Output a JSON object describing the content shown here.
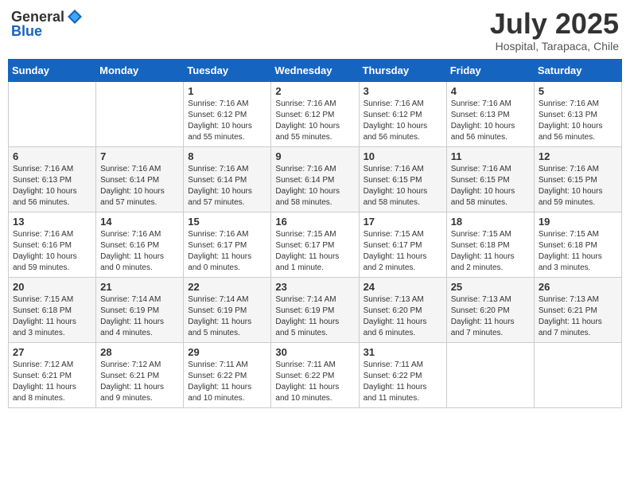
{
  "header": {
    "logo_general": "General",
    "logo_blue": "Blue",
    "main_title": "July 2025",
    "subtitle": "Hospital, Tarapaca, Chile"
  },
  "weekdays": [
    "Sunday",
    "Monday",
    "Tuesday",
    "Wednesday",
    "Thursday",
    "Friday",
    "Saturday"
  ],
  "weeks": [
    [
      {
        "day": "",
        "info": ""
      },
      {
        "day": "",
        "info": ""
      },
      {
        "day": "1",
        "info": "Sunrise: 7:16 AM\nSunset: 6:12 PM\nDaylight: 10 hours and 55 minutes."
      },
      {
        "day": "2",
        "info": "Sunrise: 7:16 AM\nSunset: 6:12 PM\nDaylight: 10 hours and 55 minutes."
      },
      {
        "day": "3",
        "info": "Sunrise: 7:16 AM\nSunset: 6:12 PM\nDaylight: 10 hours and 56 minutes."
      },
      {
        "day": "4",
        "info": "Sunrise: 7:16 AM\nSunset: 6:13 PM\nDaylight: 10 hours and 56 minutes."
      },
      {
        "day": "5",
        "info": "Sunrise: 7:16 AM\nSunset: 6:13 PM\nDaylight: 10 hours and 56 minutes."
      }
    ],
    [
      {
        "day": "6",
        "info": "Sunrise: 7:16 AM\nSunset: 6:13 PM\nDaylight: 10 hours and 56 minutes."
      },
      {
        "day": "7",
        "info": "Sunrise: 7:16 AM\nSunset: 6:14 PM\nDaylight: 10 hours and 57 minutes."
      },
      {
        "day": "8",
        "info": "Sunrise: 7:16 AM\nSunset: 6:14 PM\nDaylight: 10 hours and 57 minutes."
      },
      {
        "day": "9",
        "info": "Sunrise: 7:16 AM\nSunset: 6:14 PM\nDaylight: 10 hours and 58 minutes."
      },
      {
        "day": "10",
        "info": "Sunrise: 7:16 AM\nSunset: 6:15 PM\nDaylight: 10 hours and 58 minutes."
      },
      {
        "day": "11",
        "info": "Sunrise: 7:16 AM\nSunset: 6:15 PM\nDaylight: 10 hours and 58 minutes."
      },
      {
        "day": "12",
        "info": "Sunrise: 7:16 AM\nSunset: 6:15 PM\nDaylight: 10 hours and 59 minutes."
      }
    ],
    [
      {
        "day": "13",
        "info": "Sunrise: 7:16 AM\nSunset: 6:16 PM\nDaylight: 10 hours and 59 minutes."
      },
      {
        "day": "14",
        "info": "Sunrise: 7:16 AM\nSunset: 6:16 PM\nDaylight: 11 hours and 0 minutes."
      },
      {
        "day": "15",
        "info": "Sunrise: 7:16 AM\nSunset: 6:17 PM\nDaylight: 11 hours and 0 minutes."
      },
      {
        "day": "16",
        "info": "Sunrise: 7:15 AM\nSunset: 6:17 PM\nDaylight: 11 hours and 1 minute."
      },
      {
        "day": "17",
        "info": "Sunrise: 7:15 AM\nSunset: 6:17 PM\nDaylight: 11 hours and 2 minutes."
      },
      {
        "day": "18",
        "info": "Sunrise: 7:15 AM\nSunset: 6:18 PM\nDaylight: 11 hours and 2 minutes."
      },
      {
        "day": "19",
        "info": "Sunrise: 7:15 AM\nSunset: 6:18 PM\nDaylight: 11 hours and 3 minutes."
      }
    ],
    [
      {
        "day": "20",
        "info": "Sunrise: 7:15 AM\nSunset: 6:18 PM\nDaylight: 11 hours and 3 minutes."
      },
      {
        "day": "21",
        "info": "Sunrise: 7:14 AM\nSunset: 6:19 PM\nDaylight: 11 hours and 4 minutes."
      },
      {
        "day": "22",
        "info": "Sunrise: 7:14 AM\nSunset: 6:19 PM\nDaylight: 11 hours and 5 minutes."
      },
      {
        "day": "23",
        "info": "Sunrise: 7:14 AM\nSunset: 6:19 PM\nDaylight: 11 hours and 5 minutes."
      },
      {
        "day": "24",
        "info": "Sunrise: 7:13 AM\nSunset: 6:20 PM\nDaylight: 11 hours and 6 minutes."
      },
      {
        "day": "25",
        "info": "Sunrise: 7:13 AM\nSunset: 6:20 PM\nDaylight: 11 hours and 7 minutes."
      },
      {
        "day": "26",
        "info": "Sunrise: 7:13 AM\nSunset: 6:21 PM\nDaylight: 11 hours and 7 minutes."
      }
    ],
    [
      {
        "day": "27",
        "info": "Sunrise: 7:12 AM\nSunset: 6:21 PM\nDaylight: 11 hours and 8 minutes."
      },
      {
        "day": "28",
        "info": "Sunrise: 7:12 AM\nSunset: 6:21 PM\nDaylight: 11 hours and 9 minutes."
      },
      {
        "day": "29",
        "info": "Sunrise: 7:11 AM\nSunset: 6:22 PM\nDaylight: 11 hours and 10 minutes."
      },
      {
        "day": "30",
        "info": "Sunrise: 7:11 AM\nSunset: 6:22 PM\nDaylight: 11 hours and 10 minutes."
      },
      {
        "day": "31",
        "info": "Sunrise: 7:11 AM\nSunset: 6:22 PM\nDaylight: 11 hours and 11 minutes."
      },
      {
        "day": "",
        "info": ""
      },
      {
        "day": "",
        "info": ""
      }
    ]
  ]
}
